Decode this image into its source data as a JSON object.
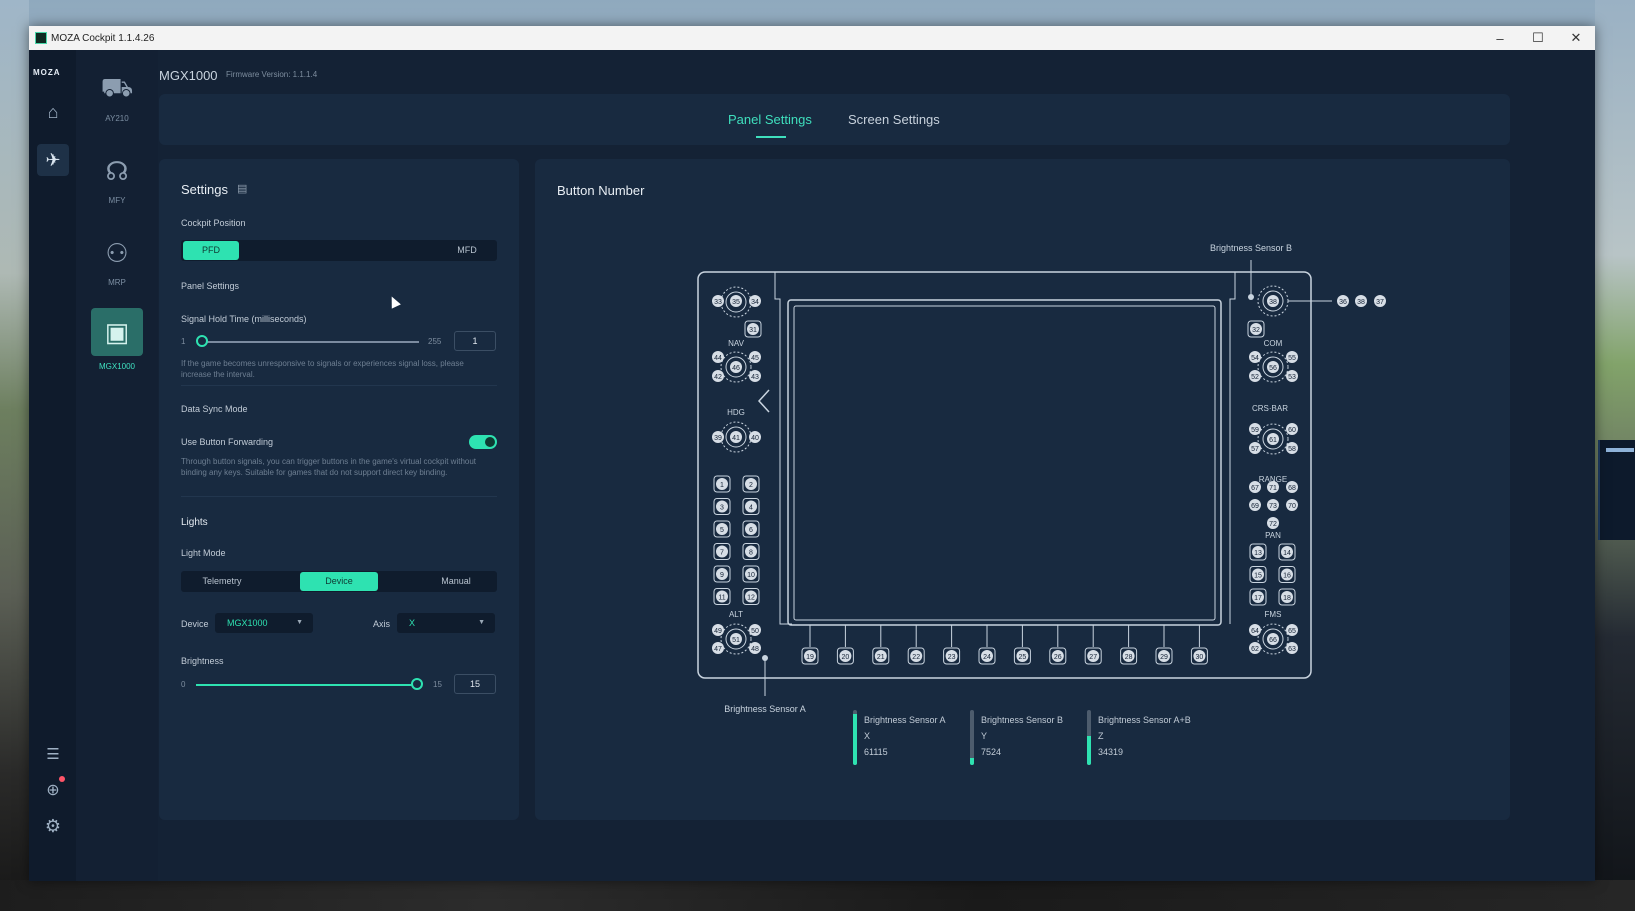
{
  "window": {
    "title": "MOZA Cockpit 1.1.4.26",
    "minimize": "–",
    "maximize": "☐",
    "close": "✕"
  },
  "rail": {
    "logo": "MOZA"
  },
  "devices": [
    {
      "label": "AY210"
    },
    {
      "label": "MFY"
    },
    {
      "label": "MRP"
    },
    {
      "label": "MGX1000"
    }
  ],
  "header": {
    "device_name": "MGX1000",
    "firmware": "Firmware Version: 1.1.1.4"
  },
  "tabs": {
    "panel": "Panel Settings",
    "screen": "Screen Settings"
  },
  "settings": {
    "title": "Settings",
    "cockpit_position": {
      "label": "Cockpit Position",
      "options": [
        "PFD",
        "MFD"
      ],
      "selected": "PFD"
    },
    "panel_settings_label": "Panel Settings",
    "signal_hold": {
      "label": "Signal Hold Time (milliseconds)",
      "min": "1",
      "max": "255",
      "value": "1",
      "fraction": 0.0,
      "note": "If the game becomes unresponsive to signals or experiences signal loss, please increase the interval."
    },
    "data_sync": {
      "label": "Data Sync Mode",
      "forwarding_label": "Use Button Forwarding",
      "enabled": true,
      "note": "Through button signals, you can trigger buttons in the game's virtual cockpit without binding any keys. Suitable for games that do not support direct key binding."
    },
    "lights": {
      "title": "Lights",
      "mode_label": "Light Mode",
      "options": [
        "Telemetry",
        "Device",
        "Manual"
      ],
      "selected": "Device",
      "device_label": "Device",
      "device_value": "MGX1000",
      "axis_label": "Axis",
      "axis_value": "X",
      "brightness_label": "Brightness",
      "brightness_min": "0",
      "brightness_max": "15",
      "brightness_value": "15",
      "brightness_fraction": 1.0
    }
  },
  "diagram": {
    "title": "Button Number",
    "sensor_b_label": "Brightness Sensor B",
    "sensor_a_label": "Brightness Sensor A",
    "top_right_buttons": [
      "36",
      "38",
      "37"
    ],
    "left_top": [
      "33",
      "35",
      "34",
      "31"
    ],
    "nav_label": "NAV",
    "nav": [
      "44",
      "45",
      "46",
      "42",
      "43"
    ],
    "hdg_label": "HDG",
    "hdg": [
      "39",
      "41",
      "40"
    ],
    "left_grid": [
      "1",
      "2",
      "3",
      "4",
      "5",
      "6",
      "7",
      "8",
      "9",
      "10",
      "11",
      "12"
    ],
    "alt_label": "ALT",
    "alt": [
      "49",
      "50",
      "51",
      "47",
      "48"
    ],
    "bottom_row": [
      "19",
      "20",
      "21",
      "22",
      "23",
      "24",
      "25",
      "26",
      "27",
      "28",
      "29",
      "30"
    ],
    "right_top": [
      "32"
    ],
    "com_label": "COM",
    "com": [
      "54",
      "55",
      "56",
      "52",
      "53"
    ],
    "crs_label": "CRS·BAR",
    "crs": [
      "59",
      "60",
      "61",
      "57",
      "58"
    ],
    "range_label": "RANGE",
    "range": [
      "67",
      "71",
      "68",
      "69",
      "73",
      "70",
      "72"
    ],
    "pan_label": "PAN",
    "right_grid": [
      "13",
      "14",
      "15",
      "16",
      "17",
      "18"
    ],
    "fms_label": "FMS",
    "fms": [
      "64",
      "65",
      "66",
      "62",
      "63"
    ]
  },
  "legend": [
    {
      "name": "Brightness Sensor A",
      "axis": "X",
      "value": "61115",
      "fraction": 0.93
    },
    {
      "name": "Brightness Sensor B",
      "axis": "Y",
      "value": "7524",
      "fraction": 0.12
    },
    {
      "name": "Brightness Sensor A+B",
      "axis": "Z",
      "value": "34319",
      "fraction": 0.52
    }
  ],
  "colors": {
    "accent": "#2ee2b1",
    "panel": "#182a40",
    "background": "#142235"
  }
}
